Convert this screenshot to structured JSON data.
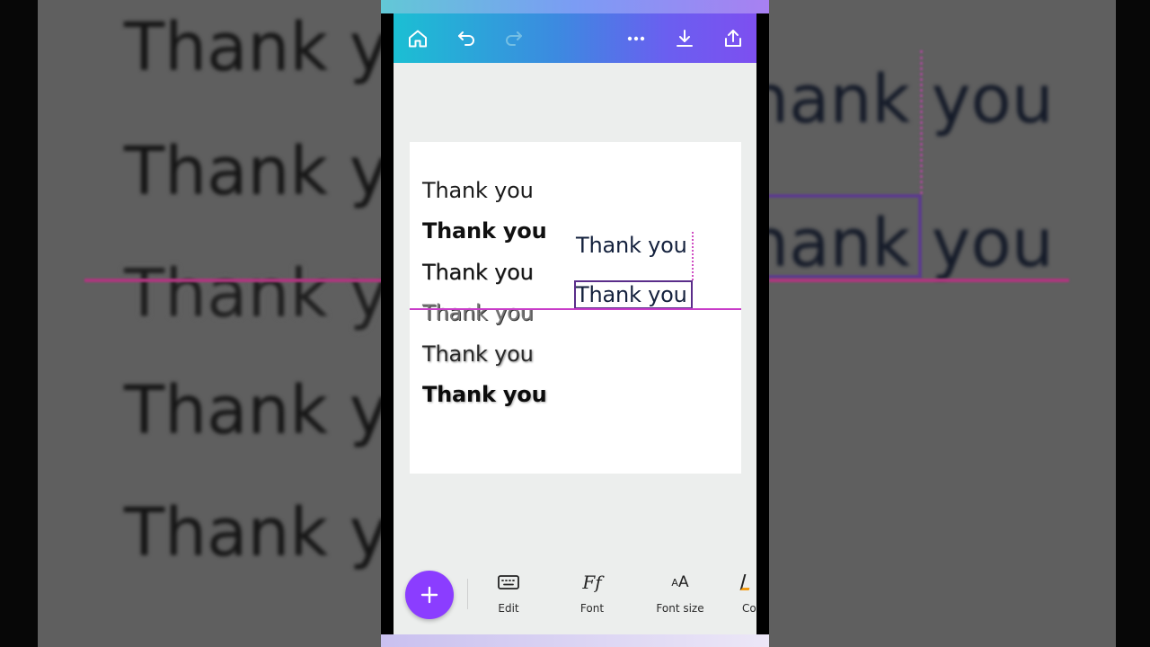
{
  "background": {
    "text": "Thank you"
  },
  "toolbar": {
    "icons": [
      "home-icon",
      "undo-icon",
      "redo-icon",
      "more-icon",
      "download-icon",
      "share-icon"
    ]
  },
  "canvas": {
    "left_column": [
      "Thank you",
      "Thank you",
      "Thank you",
      "Thank you",
      "Thank you",
      "Thank you"
    ],
    "right_column": [
      "Thank you",
      "Thank you"
    ]
  },
  "bottom_bar": {
    "add_label": "+",
    "tools": [
      {
        "icon": "keyboard-icon",
        "label": "Edit"
      },
      {
        "icon": "font-icon",
        "glyph": "Ff",
        "label": "Font"
      },
      {
        "icon": "font-size-icon",
        "glyph": "AA",
        "label": "Font size"
      },
      {
        "icon": "color-icon",
        "label": "Co"
      }
    ]
  },
  "colors": {
    "accent": "#8b3dff",
    "guide": "#c83cc8",
    "toolbar_start": "#1bbfd3",
    "toolbar_end": "#7d4ff0"
  }
}
